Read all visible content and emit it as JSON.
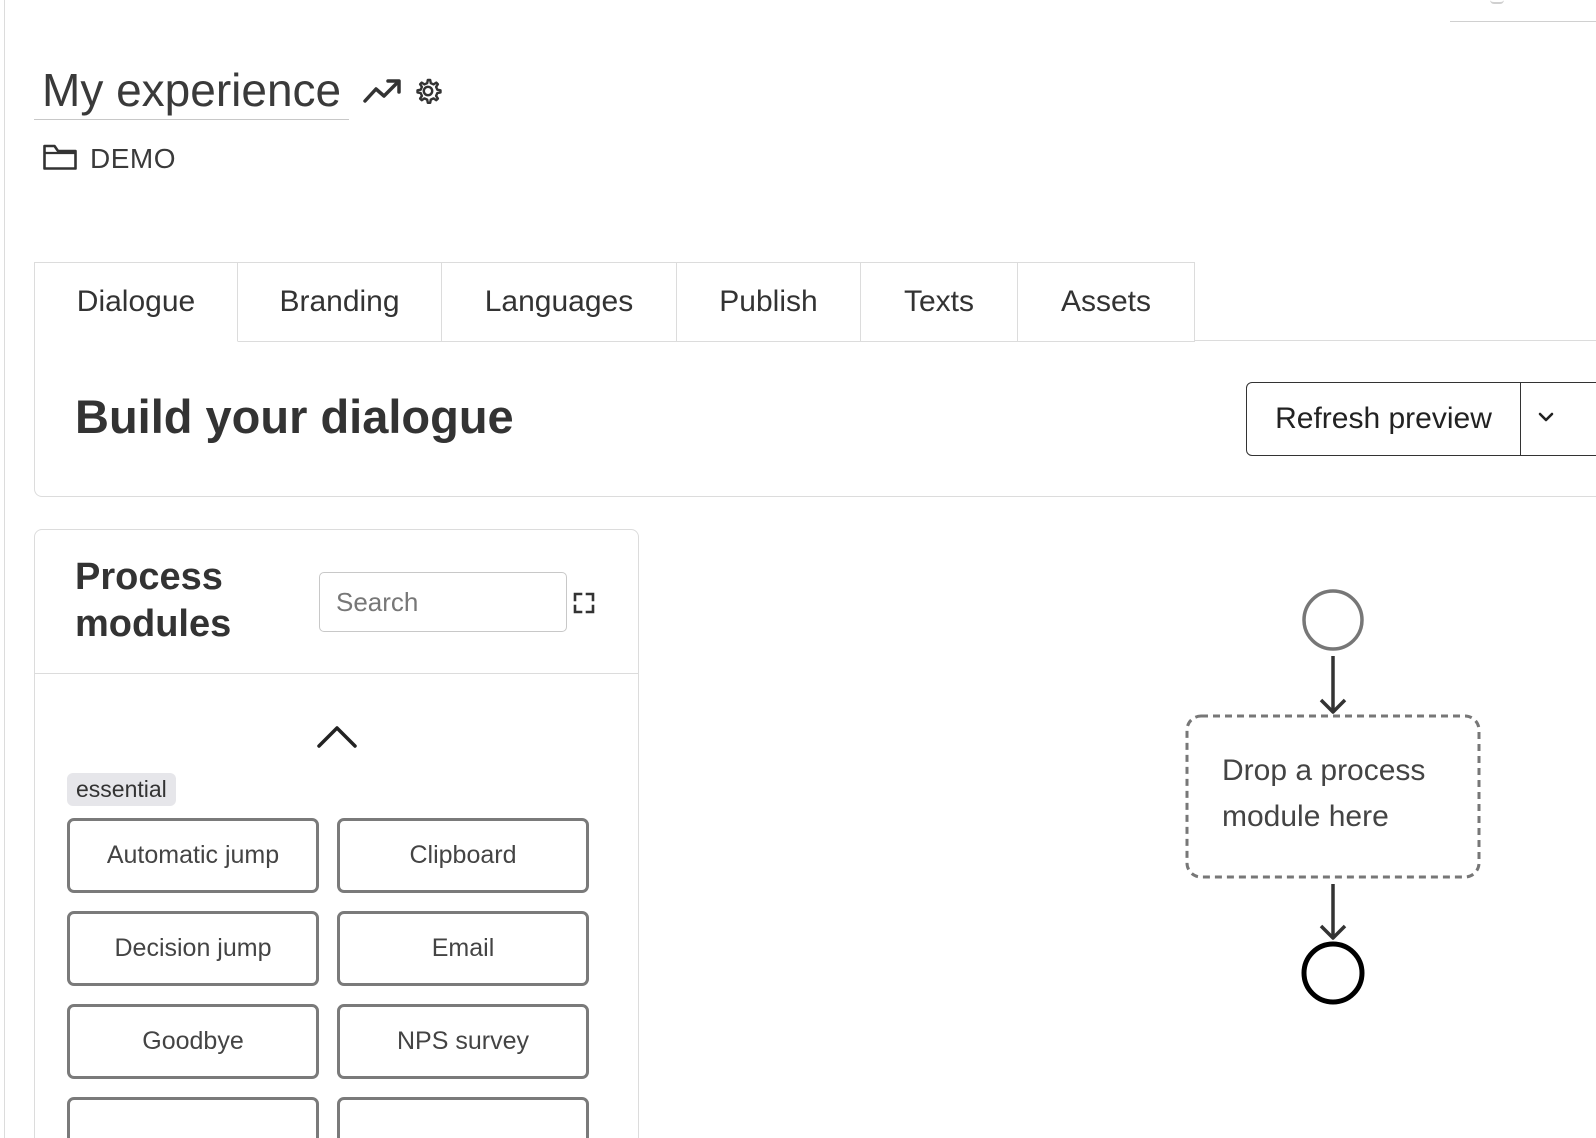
{
  "experience": {
    "title": "My experience",
    "folder": "DEMO"
  },
  "tabs": [
    {
      "label": "Dialogue",
      "active": true
    },
    {
      "label": "Branding",
      "active": false
    },
    {
      "label": "Languages",
      "active": false
    },
    {
      "label": "Publish",
      "active": false
    },
    {
      "label": "Texts",
      "active": false
    },
    {
      "label": "Assets",
      "active": false
    }
  ],
  "builder": {
    "title": "Build your dialogue",
    "refresh_label": "Refresh preview"
  },
  "modules": {
    "title": "Process modules",
    "search_placeholder": "Search",
    "category": "essential",
    "items": [
      "Automatic jump",
      "Clipboard",
      "Decision jump",
      "Email",
      "Goodbye",
      "NPS survey"
    ]
  },
  "canvas": {
    "drop_text": "Drop a process module here"
  },
  "icons": {
    "trend": "trending-up-icon",
    "settings": "gear-icon",
    "folder": "folder-icon",
    "expand": "expand-icon",
    "collapse": "chevron-up-icon",
    "dropdown": "chevron-down-icon"
  },
  "colors": {
    "border": "#dcdcdc",
    "text": "#333333",
    "module_border": "#7a7a7a",
    "badge_bg": "#e6e6ea"
  }
}
